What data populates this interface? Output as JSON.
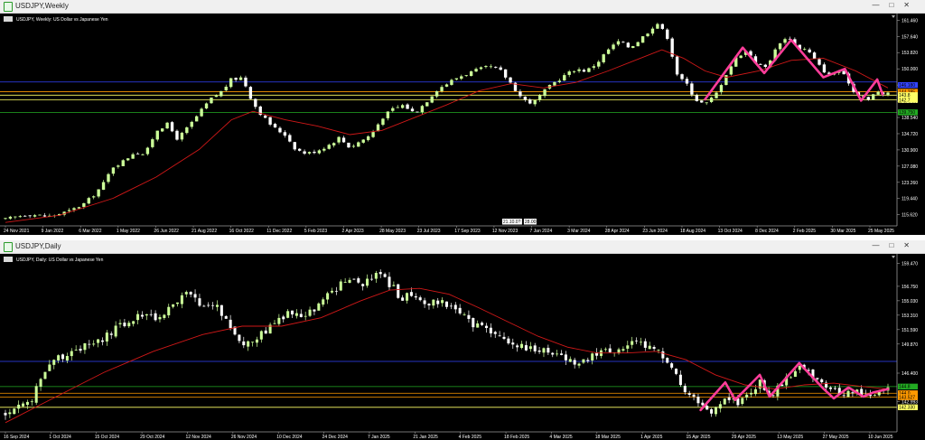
{
  "top_window": {
    "title": "USDJPY,Weekly",
    "header_text": "USDJPY, Weekly: US Dollar vs Japanese Yen",
    "controls": [
      "—",
      "□",
      "✕"
    ]
  },
  "bottom_window": {
    "title": "USDJPY,Daily",
    "header_text": "USDJPY, Daily: US Dollar vs Japanese Yen",
    "controls": [
      "—",
      "□",
      "✕"
    ]
  },
  "colors": {
    "background": "#000000",
    "bull_candle": "#ccff99",
    "bear_candle": "#ffffff",
    "moving_average": "#d01818",
    "pattern": "#ff3d9a",
    "hline_blue": "#3344ff",
    "hline_orange": "#ff9900",
    "hline_yellow": "#ffff66",
    "hline_green": "#22aa22",
    "axis_text": "#ffffff"
  },
  "chart_data": [
    {
      "type": "candlestick",
      "title": "USDJPY, Weekly: US Dollar vs Japanese Yen",
      "timeframe": "Weekly",
      "ylim": [
        113.0,
        162.6
      ],
      "y_ticks": [
        "161.460",
        "157.640",
        "153.820",
        "150.000",
        "146.180",
        "142.360",
        "138.540",
        "134.720",
        "130.900",
        "127.080",
        "123.260",
        "119.440",
        "115.620"
      ],
      "x_ticks": [
        "24 Nov 2021",
        "9 Jan 2022",
        "6 Mar 2022",
        "1 May 2022",
        "26 Jun 2022",
        "21 Aug 2022",
        "16 Oct 2022",
        "11 Dec 2022",
        "5 Feb 2023",
        "2 Apr 2023",
        "28 May 2023",
        "23 Jul 2023",
        "17 Sep 2023",
        "12 Nov 2023",
        "7 Jan 2024",
        "3 Mar 2024",
        "28 Apr 2024",
        "23 Jun 2024",
        "18 Aug 2024",
        "13 Oct 2024",
        "8 Dec 2024",
        "2 Feb 2025",
        "30 Mar 2025",
        "25 May 2025"
      ],
      "price_labels": [
        {
          "text": "146.180",
          "value": 146.18,
          "color": "#3344ff"
        },
        {
          "text": "144.285",
          "value": 144.6,
          "color": "#ff9900"
        },
        {
          "text": "143.8",
          "value": 143.8,
          "color": "#ffff66"
        },
        {
          "text": "142.7",
          "value": 142.7,
          "color": "#ffff66"
        },
        {
          "text": "139.750",
          "value": 139.75,
          "color": "#22aa22"
        }
      ],
      "hlines": [
        {
          "value": 146.9,
          "color": "#3344ff"
        },
        {
          "value": 144.6,
          "color": "#ff9900"
        },
        {
          "value": 143.8,
          "color": "#ffff66"
        },
        {
          "value": 142.7,
          "color": "#ffff66"
        },
        {
          "value": 139.75,
          "color": "#22aa22"
        }
      ],
      "cursor_labels": [
        "21.10.0?",
        "28.00"
      ],
      "close_path": [
        {
          "t": 0,
          "v": 114.5
        },
        {
          "t": 4,
          "v": 115.8
        },
        {
          "t": 8,
          "v": 115.2
        },
        {
          "t": 12,
          "v": 116.5
        },
        {
          "t": 15,
          "v": 118.5
        },
        {
          "t": 18,
          "v": 122.5
        },
        {
          "t": 20,
          "v": 127.0
        },
        {
          "t": 22,
          "v": 128.3
        },
        {
          "t": 24,
          "v": 130.5
        },
        {
          "t": 26,
          "v": 129.8
        },
        {
          "t": 28,
          "v": 135.5
        },
        {
          "t": 30,
          "v": 137.0
        },
        {
          "t": 32,
          "v": 133.5
        },
        {
          "t": 34,
          "v": 136.3
        },
        {
          "t": 36,
          "v": 139.5
        },
        {
          "t": 38,
          "v": 142.7
        },
        {
          "t": 40,
          "v": 144.5
        },
        {
          "t": 42,
          "v": 147.5
        },
        {
          "t": 44,
          "v": 148.0
        },
        {
          "t": 46,
          "v": 142.0
        },
        {
          "t": 48,
          "v": 138.5
        },
        {
          "t": 50,
          "v": 136.0
        },
        {
          "t": 52,
          "v": 134.5
        },
        {
          "t": 54,
          "v": 131.0
        },
        {
          "t": 56,
          "v": 130.0
        },
        {
          "t": 58,
          "v": 130.8
        },
        {
          "t": 60,
          "v": 132.0
        },
        {
          "t": 62,
          "v": 133.8
        },
        {
          "t": 64,
          "v": 131.5
        },
        {
          "t": 66,
          "v": 133.0
        },
        {
          "t": 68,
          "v": 134.5
        },
        {
          "t": 70,
          "v": 138.5
        },
        {
          "t": 72,
          "v": 140.5
        },
        {
          "t": 74,
          "v": 141.5
        },
        {
          "t": 76,
          "v": 139.5
        },
        {
          "t": 78,
          "v": 142.0
        },
        {
          "t": 80,
          "v": 145.0
        },
        {
          "t": 82,
          "v": 146.5
        },
        {
          "t": 84,
          "v": 148.0
        },
        {
          "t": 86,
          "v": 149.0
        },
        {
          "t": 88,
          "v": 149.8
        },
        {
          "t": 90,
          "v": 150.5
        },
        {
          "t": 92,
          "v": 149.5
        },
        {
          "t": 94,
          "v": 146.5
        },
        {
          "t": 96,
          "v": 143.0
        },
        {
          "t": 98,
          "v": 141.8
        },
        {
          "t": 100,
          "v": 144.5
        },
        {
          "t": 102,
          "v": 146.8
        },
        {
          "t": 104,
          "v": 148.5
        },
        {
          "t": 106,
          "v": 150.0
        },
        {
          "t": 108,
          "v": 149.5
        },
        {
          "t": 110,
          "v": 151.5
        },
        {
          "t": 112,
          "v": 154.5
        },
        {
          "t": 114,
          "v": 156.5
        },
        {
          "t": 116,
          "v": 155.0
        },
        {
          "t": 118,
          "v": 157.0
        },
        {
          "t": 120,
          "v": 159.5
        },
        {
          "t": 121,
          "v": 161.0
        },
        {
          "t": 123,
          "v": 157.5
        },
        {
          "t": 125,
          "v": 148.0
        },
        {
          "t": 127,
          "v": 146.0
        },
        {
          "t": 128,
          "v": 143.0
        },
        {
          "t": 130,
          "v": 141.5
        },
        {
          "t": 132,
          "v": 144.0
        },
        {
          "t": 134,
          "v": 149.0
        },
        {
          "t": 136,
          "v": 153.0
        },
        {
          "t": 138,
          "v": 154.5
        },
        {
          "t": 139,
          "v": 152.0
        },
        {
          "t": 141,
          "v": 150.0
        },
        {
          "t": 142,
          "v": 152.0
        },
        {
          "t": 144,
          "v": 156.5
        },
        {
          "t": 146,
          "v": 157.5
        },
        {
          "t": 147,
          "v": 155.0
        },
        {
          "t": 149,
          "v": 154.5
        },
        {
          "t": 151,
          "v": 151.0
        },
        {
          "t": 153,
          "v": 148.5
        },
        {
          "t": 155,
          "v": 149.5
        },
        {
          "t": 157,
          "v": 146.5
        },
        {
          "t": 158,
          "v": 143.5
        },
        {
          "t": 159,
          "v": 144.5
        },
        {
          "t": 160,
          "v": 142.0
        },
        {
          "t": 162,
          "v": 145.0
        },
        {
          "t": 163,
          "v": 143.5
        },
        {
          "t": 164,
          "v": 144.5
        }
      ],
      "moving_average": [
        {
          "t": 0,
          "v": 113.8
        },
        {
          "t": 10,
          "v": 115.5
        },
        {
          "t": 20,
          "v": 119.5
        },
        {
          "t": 28,
          "v": 124.5
        },
        {
          "t": 36,
          "v": 131.0
        },
        {
          "t": 42,
          "v": 138.0
        },
        {
          "t": 46,
          "v": 140.0
        },
        {
          "t": 52,
          "v": 138.0
        },
        {
          "t": 58,
          "v": 136.5
        },
        {
          "t": 64,
          "v": 134.5
        },
        {
          "t": 70,
          "v": 135.5
        },
        {
          "t": 76,
          "v": 138.5
        },
        {
          "t": 82,
          "v": 141.5
        },
        {
          "t": 88,
          "v": 144.8
        },
        {
          "t": 94,
          "v": 146.5
        },
        {
          "t": 100,
          "v": 145.5
        },
        {
          "t": 106,
          "v": 146.8
        },
        {
          "t": 112,
          "v": 149.5
        },
        {
          "t": 118,
          "v": 152.5
        },
        {
          "t": 122,
          "v": 154.5
        },
        {
          "t": 126,
          "v": 152.5
        },
        {
          "t": 130,
          "v": 149.5
        },
        {
          "t": 134,
          "v": 148.0
        },
        {
          "t": 140,
          "v": 149.5
        },
        {
          "t": 146,
          "v": 152.0
        },
        {
          "t": 152,
          "v": 152.5
        },
        {
          "t": 158,
          "v": 149.5
        },
        {
          "t": 164,
          "v": 145.5
        }
      ],
      "pattern": [
        {
          "t": 130,
          "v": 142.8
        },
        {
          "t": 137,
          "v": 155.0
        },
        {
          "t": 141,
          "v": 149.0
        },
        {
          "t": 146,
          "v": 156.8
        },
        {
          "t": 152,
          "v": 148.0
        },
        {
          "t": 156,
          "v": 150.0
        },
        {
          "t": 159,
          "v": 142.5
        },
        {
          "t": 162,
          "v": 147.5
        },
        {
          "t": 163,
          "v": 144.0
        }
      ]
    },
    {
      "type": "candlestick",
      "title": "USDJPY, Daily: US Dollar vs Japanese Yen",
      "timeframe": "Daily",
      "ylim": [
        139.4,
        160.4
      ],
      "y_ticks": [
        "159.470",
        "156.750",
        "155.030",
        "153.310",
        "151.590",
        "149.870",
        "146.400",
        "142.993"
      ],
      "x_ticks": [
        "16 Sep 2024",
        "1 Oct 2024",
        "15 Oct 2024",
        "29 Oct 2024",
        "12 Nov 2024",
        "26 Nov 2024",
        "10 Dec 2024",
        "24 Dec 2024",
        "7 Jan 2025",
        "21 Jan 2025",
        "4 Feb 2025",
        "18 Feb 2025",
        "4 Mar 2025",
        "18 Mar 2025",
        "1 Apr 2025",
        "15 Apr 2025",
        "29 Apr 2025",
        "13 May 2025",
        "27 May 2025",
        "10 Jun 2025"
      ],
      "price_labels": [
        {
          "text": "144.8",
          "value": 144.8,
          "color": "#22aa22"
        },
        {
          "text": "144.0",
          "value": 144.0,
          "color": "#ff9900"
        },
        {
          "text": "143.527",
          "value": 143.53,
          "color": "#ff9900"
        },
        {
          "text": "142.330",
          "value": 142.33,
          "color": "#ffff66"
        }
      ],
      "hlines": [
        {
          "value": 147.8,
          "color": "#3344ff"
        },
        {
          "value": 144.8,
          "color": "#22aa22"
        },
        {
          "value": 144.0,
          "color": "#ff9900"
        },
        {
          "value": 143.53,
          "color": "#ff9900"
        },
        {
          "value": 142.33,
          "color": "#ffff66"
        }
      ],
      "close_path": [
        {
          "t": 0,
          "v": 141.5
        },
        {
          "t": 3,
          "v": 143.0
        },
        {
          "t": 5,
          "v": 142.5
        },
        {
          "t": 7,
          "v": 146.0
        },
        {
          "t": 10,
          "v": 148.0
        },
        {
          "t": 13,
          "v": 149.0
        },
        {
          "t": 16,
          "v": 149.5
        },
        {
          "t": 19,
          "v": 150.0
        },
        {
          "t": 22,
          "v": 151.5
        },
        {
          "t": 25,
          "v": 152.5
        },
        {
          "t": 28,
          "v": 153.5
        },
        {
          "t": 31,
          "v": 153.0
        },
        {
          "t": 34,
          "v": 154.5
        },
        {
          "t": 37,
          "v": 156.0
        },
        {
          "t": 40,
          "v": 154.0
        },
        {
          "t": 43,
          "v": 154.5
        },
        {
          "t": 46,
          "v": 151.5
        },
        {
          "t": 48,
          "v": 150.0
        },
        {
          "t": 51,
          "v": 150.5
        },
        {
          "t": 54,
          "v": 152.0
        },
        {
          "t": 57,
          "v": 153.5
        },
        {
          "t": 60,
          "v": 153.0
        },
        {
          "t": 63,
          "v": 154.0
        },
        {
          "t": 66,
          "v": 156.0
        },
        {
          "t": 69,
          "v": 157.5
        },
        {
          "t": 72,
          "v": 157.0
        },
        {
          "t": 74,
          "v": 157.8
        },
        {
          "t": 76,
          "v": 158.0
        },
        {
          "t": 78,
          "v": 157.0
        },
        {
          "t": 80,
          "v": 155.5
        },
        {
          "t": 83,
          "v": 155.5
        },
        {
          "t": 86,
          "v": 154.8
        },
        {
          "t": 89,
          "v": 155.0
        },
        {
          "t": 92,
          "v": 153.5
        },
        {
          "t": 95,
          "v": 152.0
        },
        {
          "t": 98,
          "v": 151.5
        },
        {
          "t": 101,
          "v": 150.5
        },
        {
          "t": 104,
          "v": 149.5
        },
        {
          "t": 107,
          "v": 149.5
        },
        {
          "t": 110,
          "v": 149.0
        },
        {
          "t": 113,
          "v": 148.5
        },
        {
          "t": 116,
          "v": 147.5
        },
        {
          "t": 119,
          "v": 148.5
        },
        {
          "t": 122,
          "v": 149.0
        },
        {
          "t": 125,
          "v": 149.5
        },
        {
          "t": 128,
          "v": 150.0
        },
        {
          "t": 131,
          "v": 149.5
        },
        {
          "t": 133,
          "v": 148.5
        },
        {
          "t": 135,
          "v": 147.0
        },
        {
          "t": 137,
          "v": 145.0
        },
        {
          "t": 139,
          "v": 143.5
        },
        {
          "t": 141,
          "v": 143.0
        },
        {
          "t": 143,
          "v": 141.8
        },
        {
          "t": 145,
          "v": 142.5
        },
        {
          "t": 147,
          "v": 143.5
        },
        {
          "t": 149,
          "v": 142.8
        },
        {
          "t": 151,
          "v": 144.0
        },
        {
          "t": 153,
          "v": 145.5
        },
        {
          "t": 155,
          "v": 143.5
        },
        {
          "t": 157,
          "v": 145.0
        },
        {
          "t": 159,
          "v": 146.0
        },
        {
          "t": 161,
          "v": 147.5
        },
        {
          "t": 163,
          "v": 146.5
        },
        {
          "t": 165,
          "v": 145.0
        },
        {
          "t": 167,
          "v": 144.5
        },
        {
          "t": 169,
          "v": 143.8
        },
        {
          "t": 171,
          "v": 144.5
        },
        {
          "t": 173,
          "v": 144.0
        },
        {
          "t": 175,
          "v": 143.2
        },
        {
          "t": 177,
          "v": 144.2
        },
        {
          "t": 179,
          "v": 144.6
        }
      ],
      "moving_average": [
        {
          "t": 0,
          "v": 140.5
        },
        {
          "t": 10,
          "v": 143.5
        },
        {
          "t": 20,
          "v": 146.5
        },
        {
          "t": 30,
          "v": 149.0
        },
        {
          "t": 40,
          "v": 151.0
        },
        {
          "t": 48,
          "v": 152.0
        },
        {
          "t": 56,
          "v": 152.0
        },
        {
          "t": 64,
          "v": 153.0
        },
        {
          "t": 72,
          "v": 155.0
        },
        {
          "t": 78,
          "v": 156.3
        },
        {
          "t": 84,
          "v": 156.5
        },
        {
          "t": 90,
          "v": 155.8
        },
        {
          "t": 96,
          "v": 154.2
        },
        {
          "t": 102,
          "v": 152.5
        },
        {
          "t": 108,
          "v": 150.8
        },
        {
          "t": 114,
          "v": 149.5
        },
        {
          "t": 120,
          "v": 148.8
        },
        {
          "t": 126,
          "v": 148.8
        },
        {
          "t": 132,
          "v": 149.0
        },
        {
          "t": 138,
          "v": 148.0
        },
        {
          "t": 144,
          "v": 146.2
        },
        {
          "t": 150,
          "v": 145.0
        },
        {
          "t": 156,
          "v": 144.5
        },
        {
          "t": 162,
          "v": 145.0
        },
        {
          "t": 168,
          "v": 145.2
        },
        {
          "t": 174,
          "v": 144.8
        },
        {
          "t": 179,
          "v": 144.5
        }
      ],
      "pattern": [
        {
          "t": 141,
          "v": 142.0
        },
        {
          "t": 146,
          "v": 145.3
        },
        {
          "t": 148,
          "v": 143.2
        },
        {
          "t": 153,
          "v": 146.2
        },
        {
          "t": 155,
          "v": 143.6
        },
        {
          "t": 161,
          "v": 147.6
        },
        {
          "t": 166,
          "v": 144.5
        },
        {
          "t": 168,
          "v": 143.4
        },
        {
          "t": 171,
          "v": 144.7
        },
        {
          "t": 174,
          "v": 143.6
        },
        {
          "t": 176,
          "v": 144.1
        },
        {
          "t": 179,
          "v": 144.5
        }
      ]
    }
  ]
}
